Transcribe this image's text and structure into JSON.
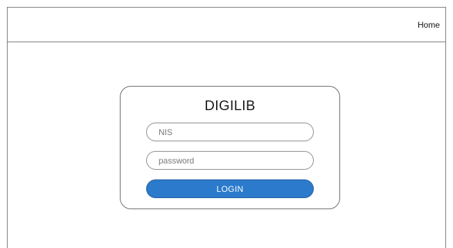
{
  "header": {
    "nav_home": "Home"
  },
  "login": {
    "title": "DIGILIB",
    "nis_placeholder": "NIS",
    "password_placeholder": "password",
    "login_label": "LOGIN"
  },
  "colors": {
    "accent": "#2b7acb",
    "border": "#7a7a7a"
  }
}
